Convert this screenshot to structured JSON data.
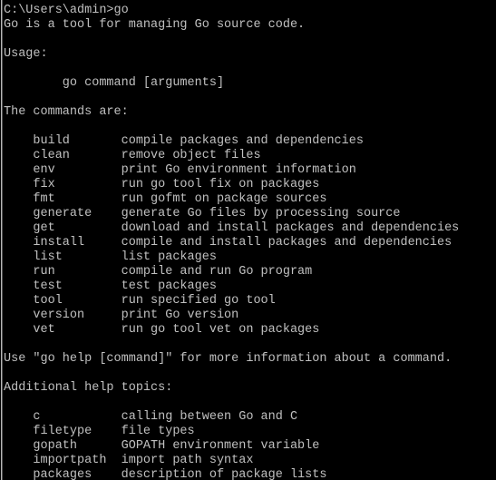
{
  "window": {
    "title": "Command Prompt",
    "background_color": "#000000",
    "text_color": "#c0c0c0",
    "scrollbar_color": "#b8b8b8"
  },
  "terminal": {
    "prompt_line": "C:\\Users\\admin>go",
    "intro_line": "Go is a tool for managing Go source code.",
    "usage_heading": "Usage:",
    "usage_line": "        go command [arguments]",
    "commands_heading": "The commands are:",
    "commands": [
      {
        "name": "build",
        "description": "compile packages and dependencies"
      },
      {
        "name": "clean",
        "description": "remove object files"
      },
      {
        "name": "env",
        "description": "print Go environment information"
      },
      {
        "name": "fix",
        "description": "run go tool fix on packages"
      },
      {
        "name": "fmt",
        "description": "run gofmt on package sources"
      },
      {
        "name": "generate",
        "description": "generate Go files by processing source"
      },
      {
        "name": "get",
        "description": "download and install packages and dependencies"
      },
      {
        "name": "install",
        "description": "compile and install packages and dependencies"
      },
      {
        "name": "list",
        "description": "list packages"
      },
      {
        "name": "run",
        "description": "compile and run Go program"
      },
      {
        "name": "test",
        "description": "test packages"
      },
      {
        "name": "tool",
        "description": "run specified go tool"
      },
      {
        "name": "version",
        "description": "print Go version"
      },
      {
        "name": "vet",
        "description": "run go tool vet on packages"
      }
    ],
    "help_hint": "Use \"go help [command]\" for more information about a command.",
    "topics_heading": "Additional help topics:",
    "topics": [
      {
        "name": "c",
        "description": "calling between Go and C"
      },
      {
        "name": "filetype",
        "description": "file types"
      },
      {
        "name": "gopath",
        "description": "GOPATH environment variable"
      },
      {
        "name": "importpath",
        "description": "import path syntax"
      },
      {
        "name": "packages",
        "description": "description of package lists"
      }
    ]
  }
}
